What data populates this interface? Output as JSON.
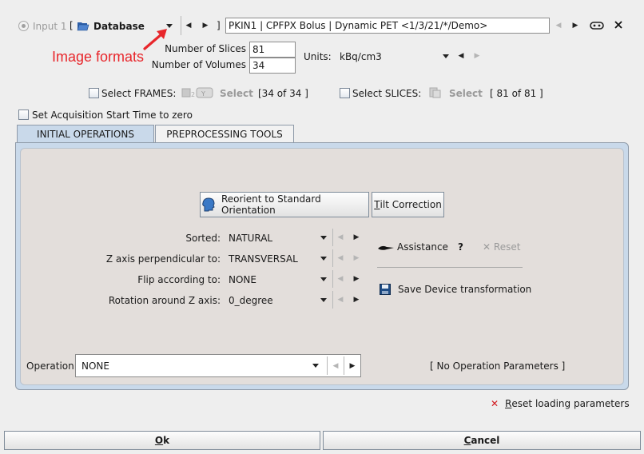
{
  "header": {
    "input_label": "Input 1",
    "bracket_open": "[",
    "bracket_close": "]",
    "source_label": "Database",
    "source_path": "PKIN1 | CPFPX Bolus | Dynamic PET <1/3/21/*/Demo>"
  },
  "annotation": {
    "text": "Image formats",
    "color": "#e8262b"
  },
  "volume_info": {
    "slices_label": "Number of Slices",
    "slices_value": "81",
    "volumes_label": "Number of Volumes",
    "volumes_value": "34",
    "units_label": "Units:",
    "units_value": "kBq/cm3"
  },
  "frames": {
    "label": "Select FRAMES:",
    "select_label": "Select",
    "count": "[34 of 34 ]"
  },
  "slices": {
    "label": "Select SLICES:",
    "select_label": "Select",
    "count": "[ 81 of 81 ]"
  },
  "acq_start_label": "Set Acquisition Start Time to zero",
  "tabs": [
    {
      "label": "INITIAL OPERATIONS",
      "active": true
    },
    {
      "label": "PREPROCESSING TOOLS",
      "active": false
    }
  ],
  "initial_ops": {
    "reorient_label": "Reorient to Standard Orientation",
    "tilt_label_first": "T",
    "tilt_label_rest": "ilt Correction",
    "fields": [
      {
        "label": "Sorted:",
        "value": "NATURAL"
      },
      {
        "label": "Z axis perpendicular to:",
        "value": "TRANSVERSAL"
      },
      {
        "label": "Flip according to:",
        "value": "NONE"
      },
      {
        "label": "Rotation around Z axis:",
        "value": "0_degree"
      }
    ],
    "assistance_label": "Assistance",
    "help_label": "?",
    "reset_label": "Reset",
    "save_device_label": "Save Device transformation",
    "operation_label": "Operation",
    "operation_value": "NONE",
    "no_params_label": "[ No Operation Parameters ]"
  },
  "reset_loading_label_first": "R",
  "reset_loading_label_rest": "eset loading parameters",
  "ok_label_first": "O",
  "ok_label_rest": "k",
  "cancel_label_first": "C",
  "cancel_label_rest": "ancel",
  "colors": {
    "accent_tab": "#c9d9ea",
    "panel_bg": "#e3dedb",
    "red_x": "#d1191f"
  }
}
